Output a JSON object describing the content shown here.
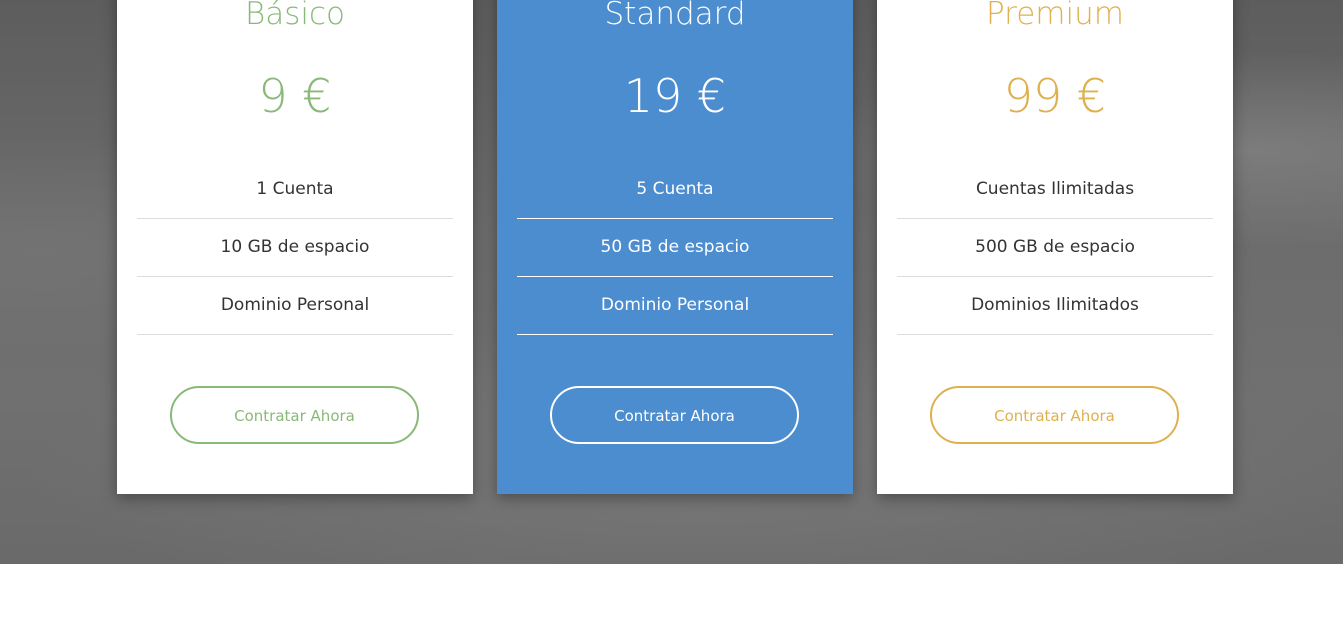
{
  "plans": [
    {
      "name": "Básico",
      "price": "9 €",
      "features": [
        "1 Cuenta",
        "10 GB de espacio",
        "Dominio Personal"
      ],
      "cta_label": "Contratar Ahora",
      "accent_color": "#89b978"
    },
    {
      "name": "Standard",
      "price": "19 €",
      "features": [
        "5 Cuenta",
        "50 GB de espacio",
        "Dominio Personal"
      ],
      "cta_label": "Contratar Ahora",
      "accent_color": "#4b8dcf"
    },
    {
      "name": "Premium",
      "price": "99 €",
      "features": [
        "Cuentas Ilimitadas",
        "500 GB de espacio",
        "Dominios Ilimitados"
      ],
      "cta_label": "Contratar Ahora",
      "accent_color": "#dfb04f"
    }
  ]
}
